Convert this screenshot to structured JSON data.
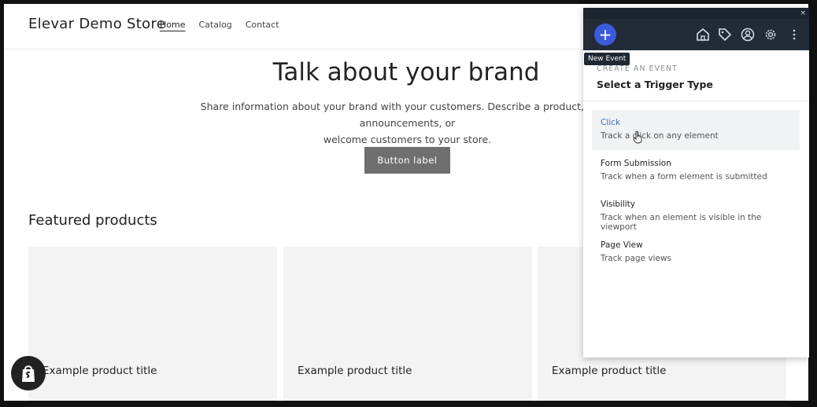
{
  "store": {
    "name": "Elevar Demo Store",
    "nav": [
      "Home",
      "Catalog",
      "Contact"
    ],
    "hero_title": "Talk about your brand",
    "hero_desc_line1": "Share information about your brand with your customers. Describe a product, make announcements, or",
    "hero_desc_line2": "welcome customers to your store.",
    "button_label": "Button label",
    "featured_title": "Featured products",
    "products": [
      "Example product title",
      "Example product title",
      "Example product title"
    ]
  },
  "panel": {
    "tooltip": "New Event",
    "close_glyph": "×",
    "add_glyph": "+",
    "create_label": "CREATE AN EVENT",
    "heading": "Select a Trigger Type",
    "options": [
      {
        "title": "Click",
        "desc": "Track a click on any element"
      },
      {
        "title": "Form Submission",
        "desc": "Track when a form element is submitted"
      },
      {
        "title": "Visibility",
        "desc": "Track when an element is visible in the viewport"
      },
      {
        "title": "Page View",
        "desc": "Track page views"
      }
    ],
    "icons": [
      "home-icon",
      "tag-icon",
      "user-icon",
      "gear-icon",
      "more-icon"
    ],
    "accent": "#3b5bdb"
  }
}
